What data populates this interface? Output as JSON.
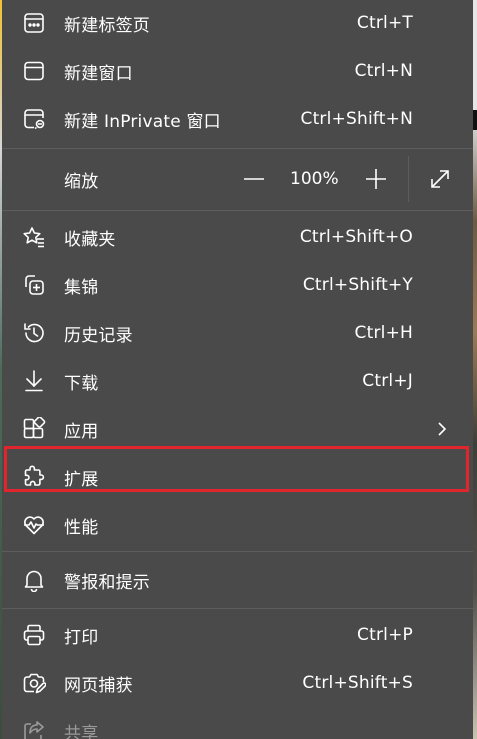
{
  "menu": {
    "new_tab": {
      "label": "新建标签页",
      "shortcut": "Ctrl+T",
      "icon": "new-tab-icon"
    },
    "new_window": {
      "label": "新建窗口",
      "shortcut": "Ctrl+N",
      "icon": "new-window-icon"
    },
    "new_inprivate": {
      "label": "新建 InPrivate 窗口",
      "shortcut": "Ctrl+Shift+N",
      "icon": "inprivate-icon"
    },
    "zoom": {
      "label": "缩放",
      "value": "100%"
    },
    "favorites": {
      "label": "收藏夹",
      "shortcut": "Ctrl+Shift+O",
      "icon": "favorites-icon"
    },
    "collections": {
      "label": "集锦",
      "shortcut": "Ctrl+Shift+Y",
      "icon": "collections-icon"
    },
    "history": {
      "label": "历史记录",
      "shortcut": "Ctrl+H",
      "icon": "history-icon"
    },
    "downloads": {
      "label": "下载",
      "shortcut": "Ctrl+J",
      "icon": "download-icon"
    },
    "apps": {
      "label": "应用",
      "icon": "apps-icon"
    },
    "extensions": {
      "label": "扩展",
      "icon": "extensions-icon"
    },
    "performance": {
      "label": "性能",
      "icon": "performance-icon"
    },
    "alerts": {
      "label": "警报和提示",
      "icon": "bell-icon"
    },
    "print": {
      "label": "打印",
      "shortcut": "Ctrl+P",
      "icon": "print-icon"
    },
    "screenshot": {
      "label": "网页捕获",
      "shortcut": "Ctrl+Shift+S",
      "icon": "web-capture-icon"
    },
    "share": {
      "label": "共享",
      "icon": "share-icon"
    }
  },
  "colors": {
    "menu_bg": "#4a4a4a",
    "divider": "#5d5d5d",
    "highlight": "#e0262c",
    "text": "#ffffff"
  }
}
